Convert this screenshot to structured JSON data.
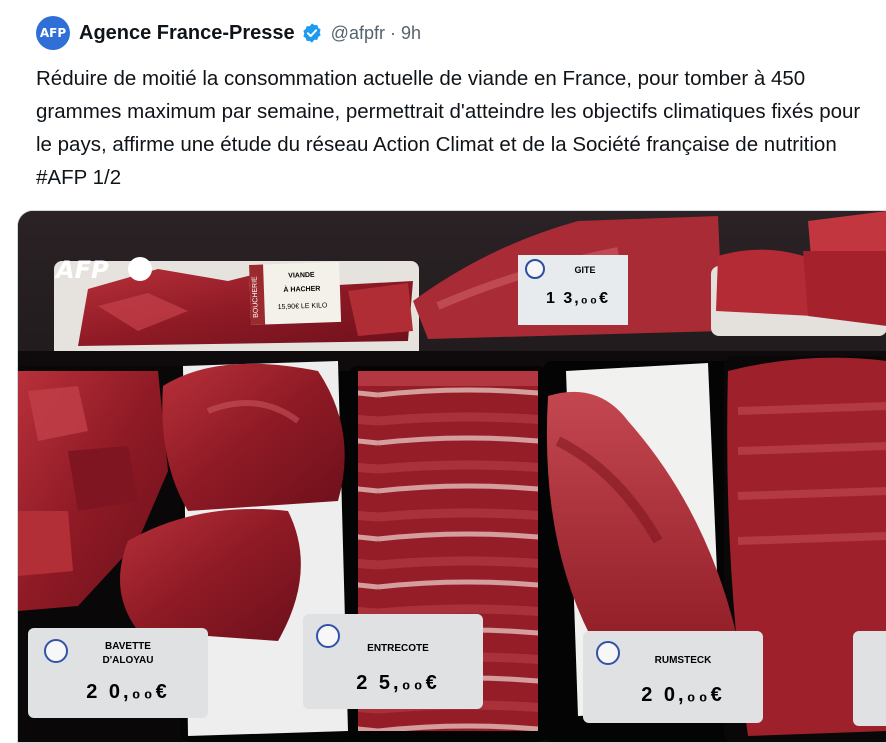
{
  "tweet": {
    "avatar_label": "AFP",
    "author_name": "Agence France-Presse",
    "handle": "@afpfr",
    "separator": "·",
    "time": "9h",
    "text": "Réduire de moitié la consommation actuelle de viande en France, pour tomber à 450 grammes maximum par semaine, permettrait d'atteindre les objectifs climatiques fixés pour le pays, affirme une étude du réseau Action Climat et de la Société française de nutrition #AFP 1/2"
  },
  "image": {
    "watermark": "AFP",
    "labels": {
      "viande_line1": "VIANDE",
      "viande_line2": "À HACHER",
      "viande_price": "15,90€ LE KILO",
      "boucherie": "BOUCHERIE",
      "gite_name": "GITE",
      "gite_price": "1 3,₀₀€",
      "bavette_line1": "BAVETTE",
      "bavette_line2": "D'ALOYAU",
      "bavette_price": "2 0,₀₀€",
      "entrecote_name": "ENTRECOTE",
      "entrecote_price": "2 5,₀₀€",
      "rumsteck_name": "RUMSTECK",
      "rumsteck_price": "2 0,₀₀€"
    }
  },
  "colors": {
    "verified": "#1d9bf0",
    "secondary_text": "#536471",
    "meat_dark": "#7a1420",
    "meat_mid": "#a3232c",
    "meat_light": "#c2404a"
  }
}
